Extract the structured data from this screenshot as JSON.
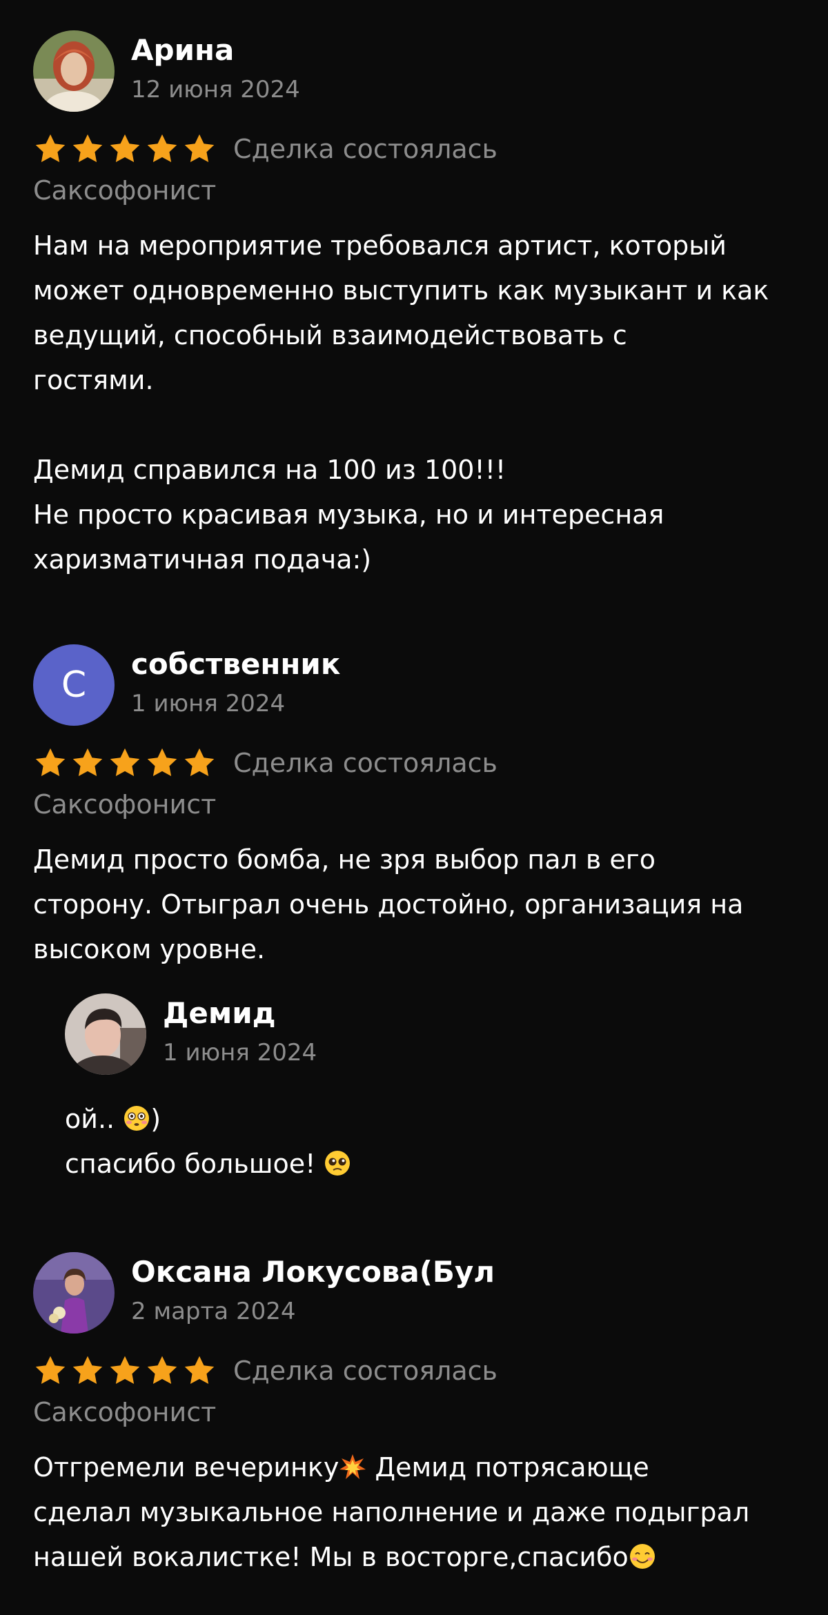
{
  "reviews": [
    {
      "author": "Арина",
      "date": "12 июня 2024",
      "rating": 5,
      "deal_status": "Сделка состоялась",
      "category": "Саксофонист",
      "text_lines": [
        "Нам на мероприятие требовался артист, который",
        "может одновременно выступить как музыкант и как",
        "ведущий, способный взаимодействовать с",
        "гостями.",
        "",
        "Демид справился на 100 из 100!!!",
        "Не просто красивая музыка, но и интересная",
        "харизматичная подача:)"
      ]
    },
    {
      "author": "собственник",
      "avatar_letter": "С",
      "date": "1 июня 2024",
      "rating": 5,
      "deal_status": "Сделка состоялась",
      "category": "Саксофонист",
      "text_lines": [
        "Демид просто бомба, не зря выбор пал в его",
        "сторону. Отыграл очень достойно, организация на",
        "высоком уровне."
      ],
      "reply": {
        "author": "Демид",
        "date": "1 июня 2024",
        "text_lines": [
          "ой..",
          ")",
          "спасибо большое!"
        ],
        "emoji": [
          "flushed-face",
          "pleading-face"
        ]
      }
    },
    {
      "author": "Оксана Локусова(Бул",
      "date": "2 марта 2024",
      "rating": 5,
      "deal_status": "Сделка состоялась",
      "category": "Саксофонист",
      "text_lines": [
        "Отгремели вечеринку",
        "Демид потрясающе",
        "сделал музыкальное наполнение и даже подыграл",
        "нашей вокалистке! Мы в восторге,спасибо"
      ],
      "emoji": [
        "collision",
        "smiling-face"
      ]
    }
  ],
  "colors": {
    "background": "#0b0b0b",
    "text": "#ffffff",
    "muted": "#8d8d8d",
    "star": "#f7a21b",
    "letter_avatar": "#5a63c9"
  }
}
